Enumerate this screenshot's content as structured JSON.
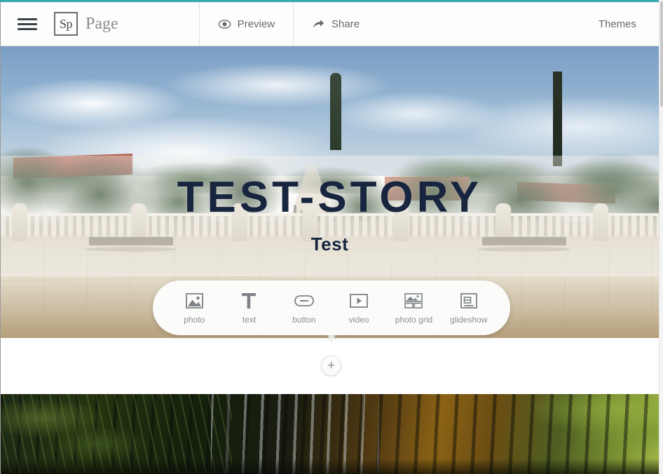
{
  "window": {
    "accent_color": "#3aa8ac",
    "scrollbar": {
      "name": "vertical-scrollbar"
    }
  },
  "header": {
    "menu_icon": "hamburger-icon",
    "brand_badge": "Sp",
    "brand_title": "Page",
    "buttons": [
      {
        "label": "Preview",
        "icon": "eye-icon"
      },
      {
        "label": "Share",
        "icon": "share-arrow-icon"
      }
    ],
    "themes_label": "Themes"
  },
  "hero": {
    "title": "TEST-STORY",
    "subtitle": "Test",
    "title_color": "#17253f",
    "image_alt": "park-vista-photo"
  },
  "insert_toolbar": {
    "items": [
      {
        "label": "photo",
        "icon": "photo-icon"
      },
      {
        "label": "text",
        "icon": "text-t-icon"
      },
      {
        "label": "button",
        "icon": "button-pill-icon"
      },
      {
        "label": "video",
        "icon": "video-play-icon"
      },
      {
        "label": "photo grid",
        "icon": "photo-grid-icon"
      },
      {
        "label": "glideshow",
        "icon": "glideshow-icon"
      }
    ],
    "add_label": "+"
  },
  "bottom_photo": {
    "image_alt": "forest-water-reflection-photo"
  }
}
